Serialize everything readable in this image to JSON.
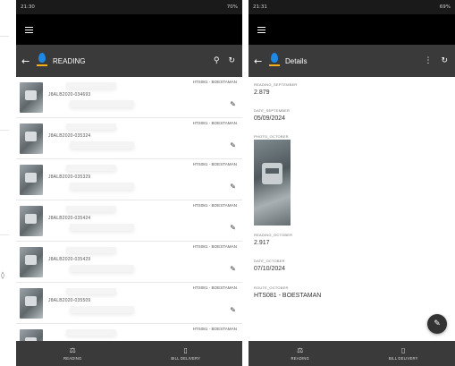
{
  "left_phone": {
    "status_time": "21:30",
    "status_right": "70%",
    "toolbar_title": "READING",
    "rows": [
      {
        "meter_id": "J8ALB2020-034693",
        "route": "HTS081 - BOESTAMAN"
      },
      {
        "meter_id": "J8ALB2020-035324",
        "route": "HTS081 - BOESTAMAN"
      },
      {
        "meter_id": "J8ALB2020-035329",
        "route": "HTS081 - BOESTAMAN"
      },
      {
        "meter_id": "J8ALB2020-035424",
        "route": "HTS081 - BOESTAMAN"
      },
      {
        "meter_id": "J8ALB2020-035429",
        "route": "HTS081 - BOESTAMAN"
      },
      {
        "meter_id": "J8ALB2020-035509",
        "route": "HTS081 - BOESTAMAN"
      },
      {
        "meter_id": "",
        "route": "HTS081 - BOESTAMAN"
      }
    ],
    "nav": [
      {
        "label": "READING",
        "icon": "meter-icon"
      },
      {
        "label": "BILL DELIVERY",
        "icon": "receipt-icon"
      }
    ]
  },
  "right_phone": {
    "status_time": "21:31",
    "status_right": "69%",
    "toolbar_title": "Details",
    "fields": {
      "reading_sept_label": "READING_SEPTEMBER",
      "reading_sept_value": "2.879",
      "date_sept_label": "DATE_SEPTEMBER",
      "date_sept_value": "05/09/2024",
      "photo_label": "PHOTO_OCTOBER",
      "reading_oct_label": "READING_OCTOBER",
      "reading_oct_value": "2.917",
      "date_oct_label": "DATE_OCTOBER",
      "date_oct_value": "07/10/2024",
      "route_label": "ROUTE_OCTOBER",
      "route_value": "HTS081 - BOESTAMAN"
    },
    "nav": [
      {
        "label": "READING",
        "icon": "meter-icon"
      },
      {
        "label": "BILL DELIVERY",
        "icon": "receipt-icon"
      }
    ]
  },
  "icons": {
    "back": "←",
    "search": "⚲",
    "refresh": "↻",
    "more": "⋮",
    "edit": "✎",
    "meter": "⚖",
    "receipt": "▯"
  }
}
